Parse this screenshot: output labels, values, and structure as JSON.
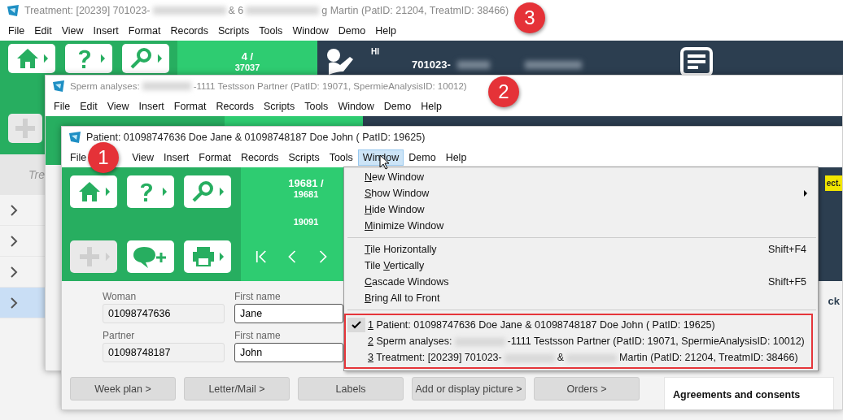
{
  "treatment_window": {
    "title_parts": [
      "Treatment: [20239] 701023-",
      "& 6",
      "g Martin  (PatID: 21204,  TreatmID: 38466)"
    ],
    "menu": [
      {
        "label": "File",
        "selected": false
      },
      {
        "label": "Edit",
        "selected": false
      },
      {
        "label": "View",
        "selected": false
      },
      {
        "label": "Insert",
        "selected": false
      },
      {
        "label": "Format",
        "selected": false
      },
      {
        "label": "Records",
        "selected": false
      },
      {
        "label": "Scripts",
        "selected": false
      },
      {
        "label": "Tools",
        "selected": false
      },
      {
        "label": "Window",
        "selected": false
      },
      {
        "label": "Demo",
        "selected": false
      },
      {
        "label": "Help",
        "selected": false
      }
    ],
    "tools": [
      {
        "kind": "home",
        "disabled": false
      },
      {
        "kind": "help",
        "disabled": false
      },
      {
        "kind": "search",
        "disabled": false
      },
      {
        "kind": "add",
        "disabled": true
      }
    ],
    "counter": [
      "4 /",
      "37037"
    ],
    "greeting": "HI",
    "patient_id_parts": [
      "701023-"
    ],
    "list_header": "Tre",
    "rows": [
      {
        "selected": false
      },
      {
        "selected": false
      },
      {
        "selected": false
      },
      {
        "selected": true
      }
    ]
  },
  "sperm_window": {
    "title_parts": [
      "Sperm analyses:",
      "-1111 Testsson Partner  (PatID: 19071, SpermieAnalysisID: 10012)"
    ],
    "menu": [
      {
        "label": "File",
        "selected": false
      },
      {
        "label": "Edit",
        "selected": false
      },
      {
        "label": "View",
        "selected": false
      },
      {
        "label": "Insert",
        "selected": false
      },
      {
        "label": "Format",
        "selected": false
      },
      {
        "label": "Records",
        "selected": false
      },
      {
        "label": "Scripts",
        "selected": false
      },
      {
        "label": "Tools",
        "selected": false
      },
      {
        "label": "Window",
        "selected": false
      },
      {
        "label": "Demo",
        "selected": false
      },
      {
        "label": "Help",
        "selected": false
      }
    ]
  },
  "patient_window": {
    "title_parts": [
      "Patient: 01098747636 Doe Jane & 01098748187 Doe John  ( PatID: 19625)"
    ],
    "menu": [
      {
        "label": "File",
        "selected": false
      },
      {
        "label": "View",
        "selected": false
      },
      {
        "label": "Insert",
        "selected": false
      },
      {
        "label": "Format",
        "selected": false
      },
      {
        "label": "Records",
        "selected": false
      },
      {
        "label": "Scripts",
        "selected": false
      },
      {
        "label": "Tools",
        "selected": false
      },
      {
        "label": "Window",
        "selected": true
      },
      {
        "label": "Demo",
        "selected": false
      },
      {
        "label": "Help",
        "selected": false
      }
    ],
    "tools": [
      {
        "kind": "home",
        "disabled": false
      },
      {
        "kind": "help",
        "disabled": false
      },
      {
        "kind": "search",
        "disabled": false
      },
      {
        "kind": "add",
        "disabled": true
      },
      {
        "kind": "comment",
        "disabled": false
      },
      {
        "kind": "print",
        "disabled": false
      }
    ],
    "counter": [
      "19681 /",
      "19681",
      "19091"
    ],
    "badge": "ect.",
    "side_text": "ck",
    "fields": [
      {
        "label": "Woman",
        "value": "01098747636",
        "readonly": true
      },
      {
        "label": "First name",
        "value": "Jane",
        "readonly": false
      },
      {
        "label": "Partner",
        "value": "01098748187",
        "readonly": true
      },
      {
        "label": "First name",
        "value": "John",
        "readonly": false
      }
    ],
    "buttons": [
      "Week plan >",
      "Letter/Mail >",
      "Labels",
      "Add or display picture >",
      "Orders >"
    ],
    "panel_title": "Agreements and consents"
  },
  "window_menu": {
    "groups": [
      [
        {
          "key": "N",
          "post": "ew Window",
          "submenu": false
        },
        {
          "key": "S",
          "post": "how Window",
          "submenu": true
        },
        {
          "key": "H",
          "post": "ide Window",
          "submenu": false
        },
        {
          "key": "M",
          "post": "inimize Window",
          "submenu": false
        }
      ],
      [
        {
          "key": "T",
          "post": "ile Horizontally",
          "shortcut": "Shift+F4",
          "submenu": false
        },
        {
          "pre": "Tile ",
          "key": "V",
          "post": "ertically",
          "submenu": false
        },
        {
          "key": "C",
          "post": "ascade Windows",
          "shortcut": "Shift+F5",
          "submenu": false
        },
        {
          "key": "B",
          "post": "ring All to Front",
          "submenu": false
        }
      ]
    ],
    "windows": [
      {
        "key": "1",
        "parts": [
          " Patient: 01098747636 Doe Jane & 01098748187 Doe John  ( PatID: 19625)"
        ],
        "checked": true
      },
      {
        "key": "2",
        "parts": [
          " Sperm analyses:",
          "-1111 Testsson Partner  (PatID: 19071, SpermieAnalysisID: 10012)"
        ],
        "checked": false
      },
      {
        "key": "3",
        "parts": [
          " Treatment: [20239] 701023-",
          "&",
          "Martin  (PatID: 21204,  TreatmID: 38466)"
        ],
        "checked": false
      }
    ]
  },
  "callouts": [
    "1",
    "2",
    "3"
  ]
}
